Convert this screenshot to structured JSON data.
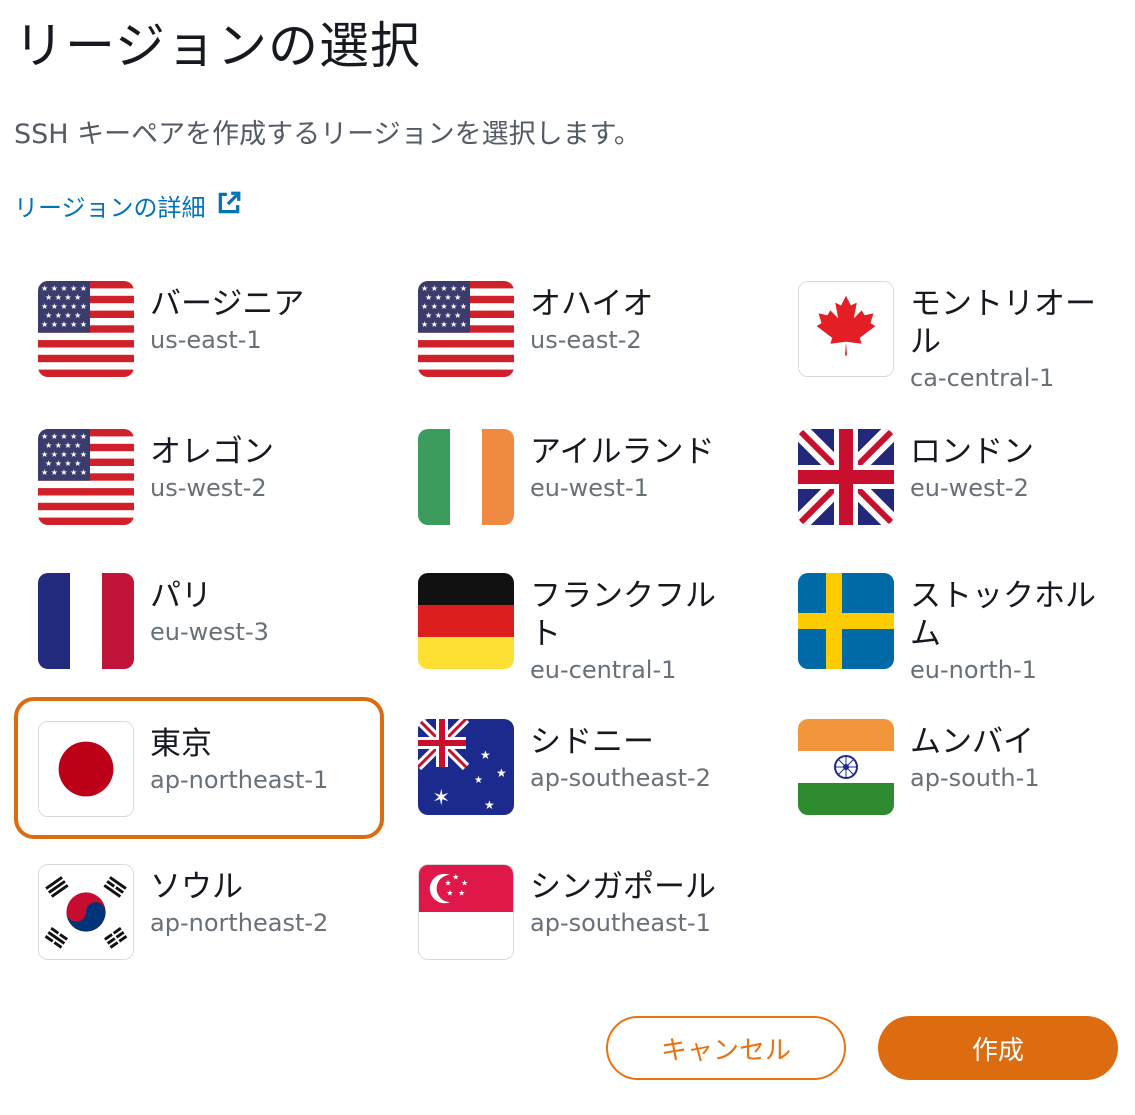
{
  "title": "リージョンの選択",
  "subtitle": "SSH キーペアを作成するリージョンを選択します。",
  "details_link": {
    "label": "リージョンの詳細",
    "icon": "external-link-icon"
  },
  "accent_color": "#dd6b10",
  "link_color": "#0073bb",
  "regions": [
    {
      "name": "バージニア",
      "code": "us-east-1",
      "flag": "us-flag-icon"
    },
    {
      "name": "オハイオ",
      "code": "us-east-2",
      "flag": "us-flag-icon"
    },
    {
      "name": "モントリオール",
      "code": "ca-central-1",
      "flag": "canada-flag-icon"
    },
    {
      "name": "オレゴン",
      "code": "us-west-2",
      "flag": "us-flag-icon"
    },
    {
      "name": "アイルランド",
      "code": "eu-west-1",
      "flag": "ireland-flag-icon"
    },
    {
      "name": "ロンドン",
      "code": "eu-west-2",
      "flag": "uk-flag-icon"
    },
    {
      "name": "パリ",
      "code": "eu-west-3",
      "flag": "france-flag-icon"
    },
    {
      "name": "フランクフルト",
      "code": "eu-central-1",
      "flag": "germany-flag-icon"
    },
    {
      "name": "ストックホルム",
      "code": "eu-north-1",
      "flag": "sweden-flag-icon"
    },
    {
      "name": "東京",
      "code": "ap-northeast-1",
      "flag": "japan-flag-icon",
      "selected": true
    },
    {
      "name": "シドニー",
      "code": "ap-southeast-2",
      "flag": "australia-flag-icon"
    },
    {
      "name": "ムンバイ",
      "code": "ap-south-1",
      "flag": "india-flag-icon"
    },
    {
      "name": "ソウル",
      "code": "ap-northeast-2",
      "flag": "korea-flag-icon"
    },
    {
      "name": "シンガポール",
      "code": "ap-southeast-1",
      "flag": "singapore-flag-icon"
    }
  ],
  "buttons": {
    "cancel": "キャンセル",
    "create": "作成"
  }
}
